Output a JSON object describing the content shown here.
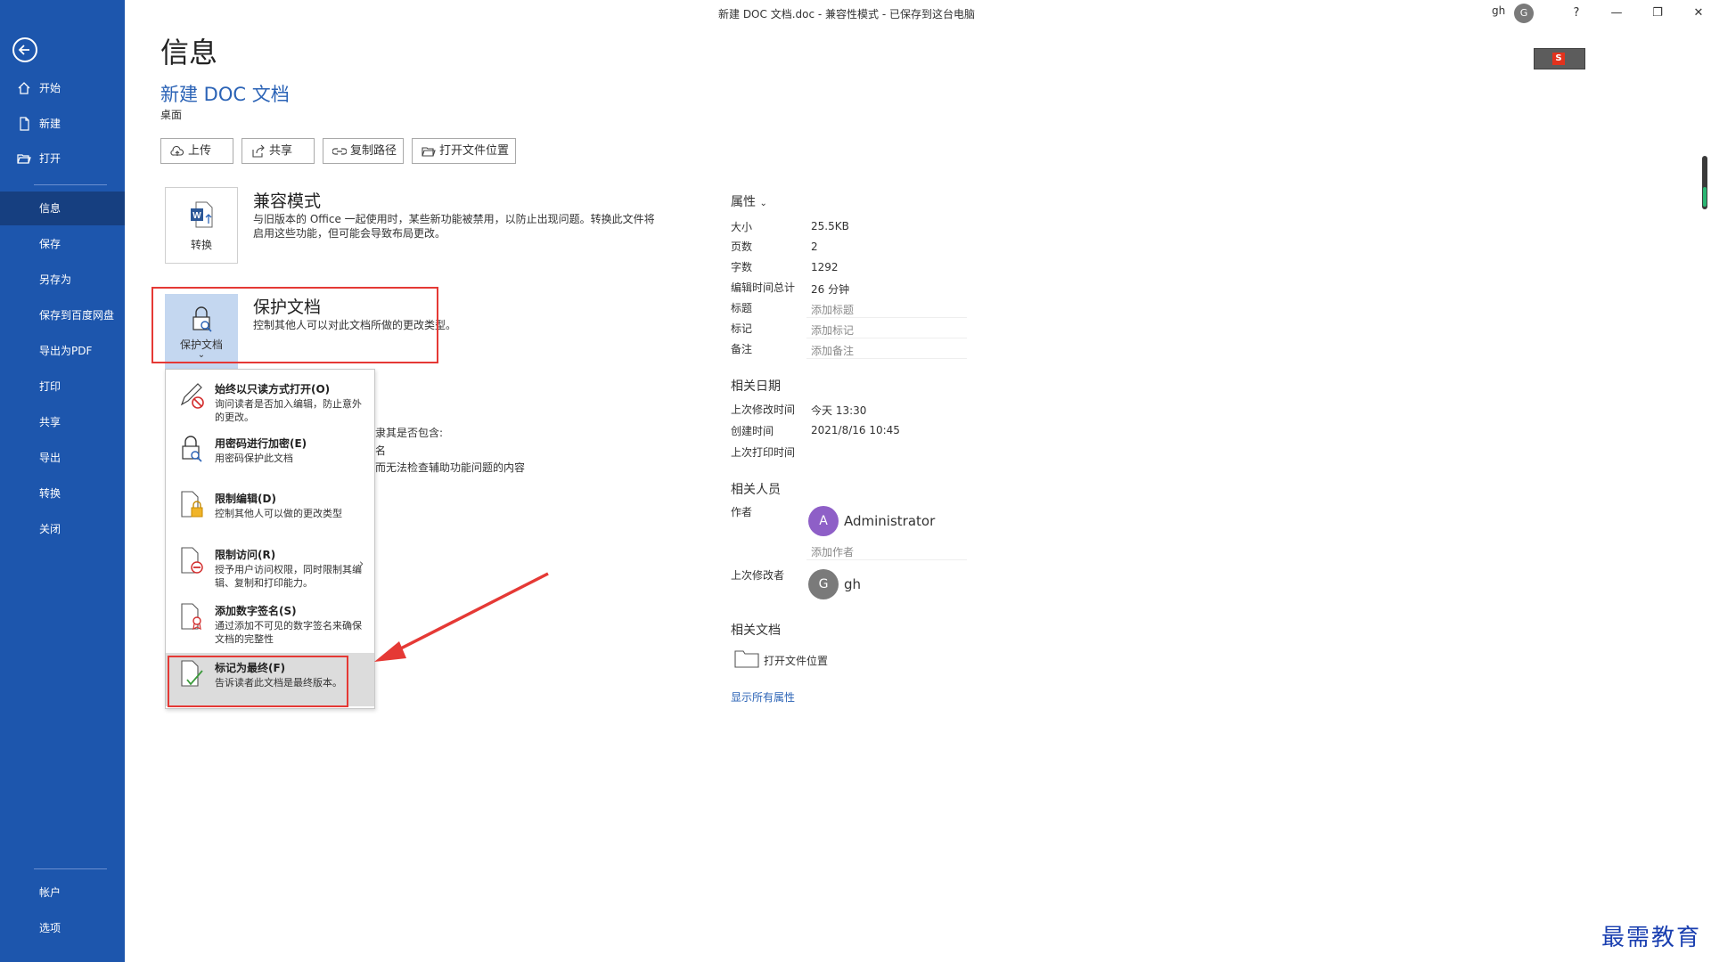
{
  "window": {
    "title": "新建 DOC 文档.doc  -  兼容性模式 - 已保存到这台电脑",
    "user_name": "gh",
    "user_initial": "G",
    "help_label": "?",
    "minimize_label": "—",
    "restore_label": "❐",
    "close_label": "✕"
  },
  "sidebar": {
    "top_items": [
      {
        "label": "开始",
        "icon": "home-icon"
      },
      {
        "label": "新建",
        "icon": "new-document-icon"
      },
      {
        "label": "打开",
        "icon": "folder-open-icon"
      }
    ],
    "items": [
      "信息",
      "保存",
      "另存为",
      "保存到百度网盘",
      "导出为PDF",
      "打印",
      "共享",
      "导出",
      "转换",
      "关闭"
    ],
    "active": "信息",
    "bottom_items": [
      "帐户",
      "选项"
    ]
  },
  "page": {
    "heading": "信息",
    "doc_title": "新建 DOC 文档",
    "doc_location": "桌面",
    "actions": [
      {
        "label": "上传",
        "icon": "upload-icon"
      },
      {
        "label": "共享",
        "icon": "share-icon"
      },
      {
        "label": "复制路径",
        "icon": "copy-path-icon"
      },
      {
        "label": "打开文件位置",
        "icon": "folder-icon"
      }
    ]
  },
  "compat": {
    "tile_label": "转换",
    "title": "兼容模式",
    "desc_line1": "与旧版本的 Office 一起使用时，某些新功能被禁用，以防止出现问题。转换此文件将",
    "desc_line2": "启用这些功能，但可能会导致布局更改。"
  },
  "protect": {
    "tile_label": "保护文档",
    "title": "保护文档",
    "desc": "控制其他人可以对此文档所做的更改类型。"
  },
  "menu": {
    "items": [
      {
        "title": "始终以只读方式打开(O)",
        "desc": "询问读者是否加入编辑，防止意外的更改。",
        "icon": "pencil-no-icon"
      },
      {
        "title": "用密码进行加密(E)",
        "desc": "用密码保护此文档",
        "icon": "lock-key-icon"
      },
      {
        "title": "限制编辑(D)",
        "desc": "控制其他人可以做的更改类型",
        "icon": "restrict-edit-icon"
      },
      {
        "title": "限制访问(R)",
        "desc": "授予用户访问权限，同时限制其编辑、复制和打印能力。",
        "icon": "restrict-access-icon"
      },
      {
        "title": "添加数字签名(S)",
        "desc": "通过添加不可见的数字签名来确保文档的完整性",
        "icon": "signature-icon"
      },
      {
        "title": "标记为最终(F)",
        "desc": "告诉读者此文档是最终版本。",
        "icon": "mark-final-icon"
      }
    ]
  },
  "behind_text": {
    "line1": "隶其是否包含:",
    "line2": "名",
    "line3": "而无法检查辅助功能问题的内容"
  },
  "properties": {
    "heading": "属性",
    "rows": [
      {
        "key": "大小",
        "value": "25.5KB",
        "placeholder": false
      },
      {
        "key": "页数",
        "value": "2",
        "placeholder": false
      },
      {
        "key": "字数",
        "value": "1292",
        "placeholder": false
      },
      {
        "key": "编辑时间总计",
        "value": "26 分钟",
        "placeholder": false
      },
      {
        "key": "标题",
        "value": "添加标题",
        "placeholder": true
      },
      {
        "key": "标记",
        "value": "添加标记",
        "placeholder": true
      },
      {
        "key": "备注",
        "value": "添加备注",
        "placeholder": true
      }
    ],
    "dates_heading": "相关日期",
    "dates": [
      {
        "key": "上次修改时间",
        "value": "今天 13:30"
      },
      {
        "key": "创建时间",
        "value": "2021/8/16 10:45"
      },
      {
        "key": "上次打印时间",
        "value": ""
      }
    ],
    "people_heading": "相关人员",
    "author_key": "作者",
    "author_name": "Administrator",
    "author_initial": "A",
    "author_color": "#8e5fc7",
    "add_author": "添加作者",
    "last_modified_key": "上次修改者",
    "modifier_name": "gh",
    "modifier_initial": "G",
    "modifier_color": "#7a7a7a",
    "docs_heading": "相关文档",
    "open_location": "打开文件位置",
    "show_all": "显示所有属性"
  },
  "watermark": "最需教育",
  "colors": {
    "sidebar": "#1d56ad",
    "sidebar_active": "#163f80",
    "accent_link": "#2b63b6",
    "highlight_box": "#e53935"
  }
}
